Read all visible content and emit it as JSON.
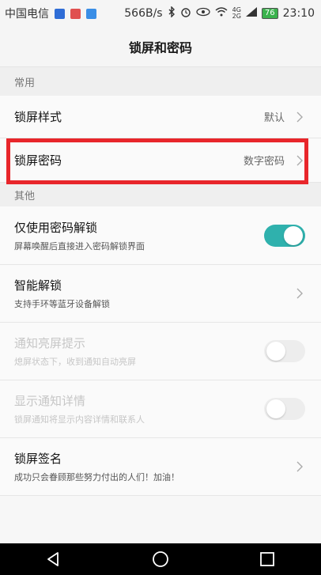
{
  "status_bar": {
    "carrier": "中国电信",
    "speed": "566B/s",
    "net_top": "4G",
    "net_bottom": "2G",
    "battery": "76",
    "time": "23:10",
    "icon_colors": [
      "#2f6dd6",
      "#e05050",
      "#3a8ee6"
    ]
  },
  "header": {
    "title": "锁屏和密码"
  },
  "sections": {
    "common": "常用",
    "other": "其他"
  },
  "rows": {
    "lock_style": {
      "title": "锁屏样式",
      "value": "默认"
    },
    "lock_password": {
      "title": "锁屏密码",
      "value": "数字密码"
    },
    "use_password_unlock": {
      "title": "仅使用密码解锁",
      "subtitle": "屏幕唤醒后直接进入密码解锁界面",
      "toggle_on": true
    },
    "smart_unlock": {
      "title": "智能解锁",
      "subtitle": "支持手环等蓝牙设备解锁"
    },
    "notification_wake": {
      "title": "通知亮屏提示",
      "subtitle": "熄屏状态下，收到通知自动亮屏",
      "toggle_on": false,
      "enabled": false
    },
    "show_notification_detail": {
      "title": "显示通知详情",
      "subtitle": "锁屏通知将显示内容详情和联系人",
      "toggle_on": false,
      "enabled": false
    },
    "lock_signature": {
      "title": "锁屏签名",
      "subtitle": "成功只会眷顾那些努力付出的人们！加油！"
    }
  },
  "colors": {
    "accent": "#2fb1ad",
    "highlight": "#e8262b"
  }
}
